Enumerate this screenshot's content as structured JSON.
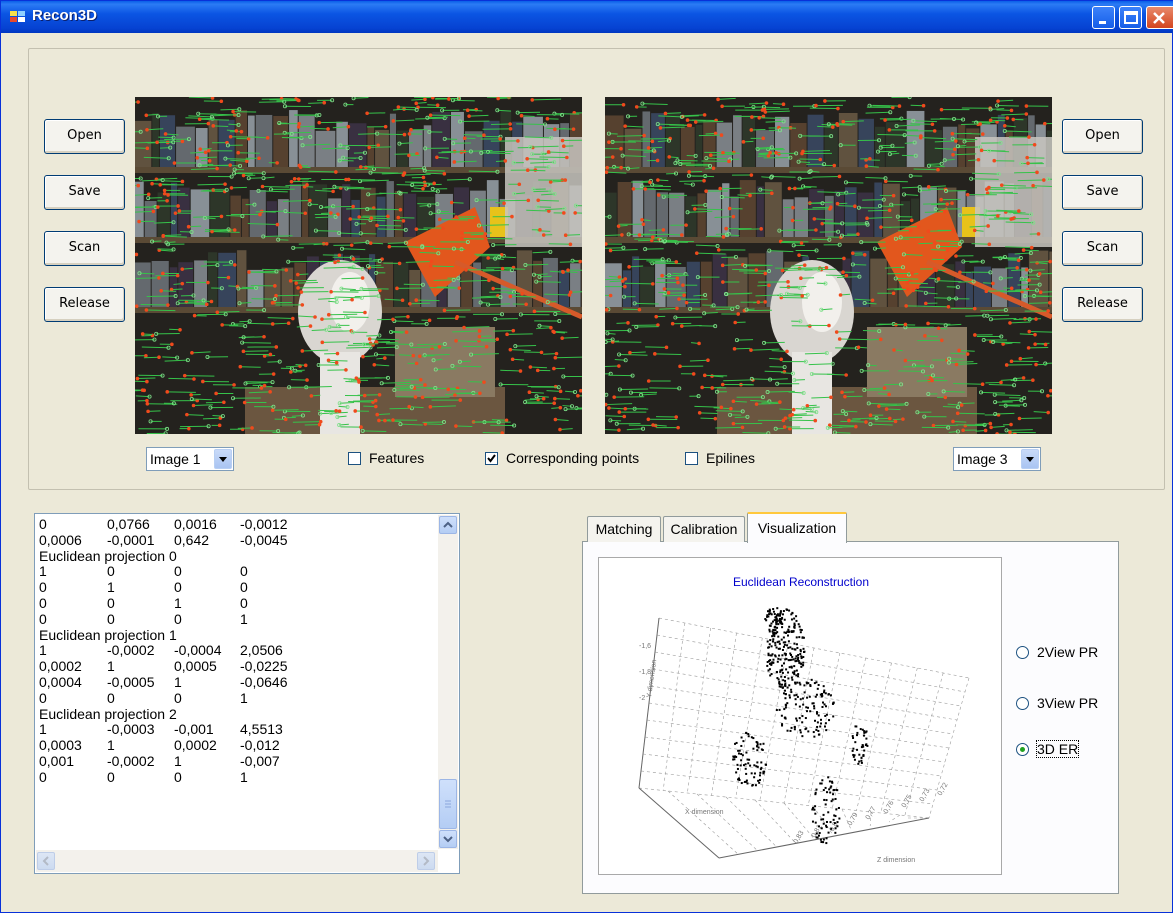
{
  "window": {
    "title": "Recon3D"
  },
  "left_panel": {
    "buttons": [
      "Open",
      "Save",
      "Scan",
      "Release"
    ],
    "image_select": "Image 1"
  },
  "right_panel": {
    "buttons": [
      "Open",
      "Save",
      "Scan",
      "Release"
    ],
    "image_select": "Image 3"
  },
  "options": {
    "features": {
      "label": "Features",
      "checked": false
    },
    "corresponding": {
      "label": "Corresponding points",
      "checked": true
    },
    "epilines": {
      "label": "Epilines",
      "checked": false
    }
  },
  "output_text": {
    "rows": [
      [
        "0",
        "0,0766",
        "0,0016",
        "-0,0012"
      ],
      [
        "0,0006",
        "-0,0001",
        "0,642",
        "-0,0045"
      ],
      [
        "Euclidean projection 0"
      ],
      [
        "1",
        "0",
        "0",
        "0"
      ],
      [
        "0",
        "1",
        "0",
        "0"
      ],
      [
        "0",
        "0",
        "1",
        "0"
      ],
      [
        "0",
        "0",
        "0",
        "1"
      ],
      [
        "Euclidean projection 1"
      ],
      [
        "1",
        "-0,0002",
        "-0,0004",
        "2,0506"
      ],
      [
        "0,0002",
        "1",
        "0,0005",
        "-0,0225"
      ],
      [
        "0,0004",
        "-0,0005",
        "1",
        "-0,0646"
      ],
      [
        "0",
        "0",
        "0",
        "1"
      ],
      [
        "Euclidean projection 2"
      ],
      [
        "1",
        "-0,0003",
        "-0,001",
        "4,5513"
      ],
      [
        "0,0003",
        "1",
        "0,0002",
        "-0,012"
      ],
      [
        "0,001",
        "-0,0002",
        "1",
        "-0,007"
      ],
      [
        "0",
        "0",
        "0",
        "1"
      ]
    ]
  },
  "tabs": [
    "Matching",
    "Calibration",
    "Visualization"
  ],
  "active_tab": "Visualization",
  "plot": {
    "title": "Euclidean Reconstruction",
    "x_label": "X dimension",
    "y_label": "Y dimension",
    "z_label": "Z dimension",
    "y_ticks": [
      "-1,6",
      "-1,8",
      "-2"
    ],
    "z_ticks": [
      "0,72",
      "0,73",
      "0,75",
      "0,76",
      "0,77",
      "0,79",
      "0,8",
      "0,81",
      "0,83"
    ]
  },
  "modes": [
    {
      "label": "2View PR",
      "selected": false
    },
    {
      "label": "3View PR",
      "selected": false
    },
    {
      "label": "3D ER",
      "selected": true
    }
  ],
  "colors": {
    "title_bar": "#0a4fdc",
    "face": "#ece9d8",
    "plot_title": "#0000cc",
    "feature_green": "#39c24a",
    "feature_red": "#e8421c"
  }
}
